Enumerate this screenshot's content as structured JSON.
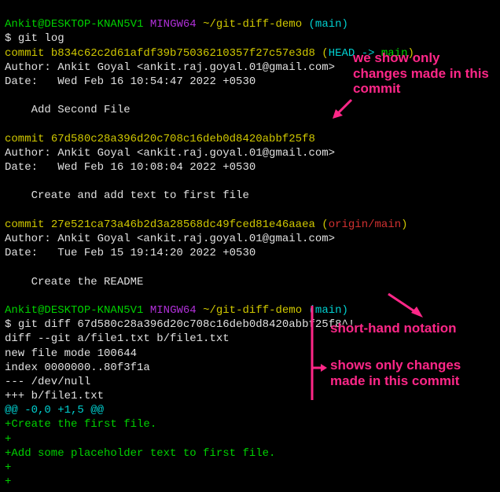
{
  "prompt1": {
    "user": "Ankit",
    "host": "DESKTOP-KNAN5V1",
    "env": "MINGW64",
    "path": "~/git-diff-demo",
    "branch": "main"
  },
  "cmd1": "git log",
  "c1": {
    "commit": "b834c62c2d61afdf39b75036210357f27c57e3d8",
    "reflabel": "HEAD -> ",
    "refbranch": "main",
    "author": "Author: Ankit Goyal <ankit.raj.goyal.01@gmail.com>",
    "date": "Date:   Wed Feb 16 10:54:47 2022 +0530",
    "msg": "    Add Second File"
  },
  "c2": {
    "commit": "67d580c28a396d20c708c16deb0d8420abbf25f8",
    "author": "Author: Ankit Goyal <ankit.raj.goyal.01@gmail.com>",
    "date": "Date:   Wed Feb 16 10:08:04 2022 +0530",
    "msg": "    Create and add text to first file"
  },
  "c3": {
    "commit": "27e521ca73a46b2d3a28568dc49fced81e46aaea",
    "refremote": "origin/main",
    "author": "Author: Ankit Goyal <ankit.raj.goyal.01@gmail.com>",
    "date": "Date:   Tue Feb 15 19:14:20 2022 +0530",
    "msg": "    Create the README"
  },
  "prompt2": {
    "user": "Ankit",
    "host": "DESKTOP-KNAN5V1",
    "env": "MINGW64",
    "path": "~/git-diff-demo",
    "branch": "main"
  },
  "cmd2": "git diff 67d580c28a396d20c708c16deb0d8420abbf25f8^!",
  "diff": {
    "header": "diff --git a/file1.txt b/file1.txt",
    "mode": "new file mode 100644",
    "index": "index 0000000..80f3f1a",
    "old": "--- /dev/null",
    "new": "+++ b/file1.txt",
    "hunk": "@@ -0,0 +1,5 @@",
    "p1": "+Create the first file.",
    "p2": "+",
    "p3": "+Add some placeholder text to first file.",
    "p4": "+",
    "p5": "+"
  },
  "anno1": "we show only changes made in this commit",
  "anno2": "short-hand notation",
  "anno3": "shows only changes made in this commit"
}
